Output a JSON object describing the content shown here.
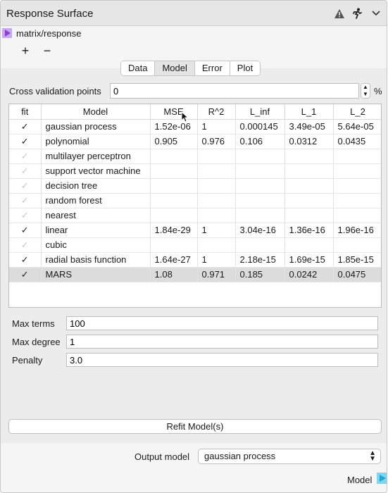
{
  "window": {
    "title": "Response Surface"
  },
  "titlebar_icons": [
    "warning-icon",
    "running-person-icon",
    "chevron-down-icon"
  ],
  "input_port": {
    "label": "matrix/response"
  },
  "buttons": {
    "add": "+",
    "remove": "−"
  },
  "tabs": [
    {
      "label": "Data",
      "active": false
    },
    {
      "label": "Model",
      "active": true
    },
    {
      "label": "Error",
      "active": false
    },
    {
      "label": "Plot",
      "active": false
    }
  ],
  "cross_validation": {
    "label": "Cross validation points",
    "value": "0",
    "unit": "%"
  },
  "table": {
    "headers": [
      "fit",
      "Model",
      "MSE",
      "R^2",
      "L_inf",
      "L_1",
      "L_2"
    ],
    "rows": [
      {
        "fit": true,
        "model": "gaussian process",
        "mse": "1.52e-06",
        "r2": "1",
        "linf": "0.000145",
        "l1": "3.49e-05",
        "l2": "5.64e-05"
      },
      {
        "fit": true,
        "model": "polynomial",
        "mse": "0.905",
        "r2": "0.976",
        "linf": "0.106",
        "l1": "0.0312",
        "l2": "0.0435"
      },
      {
        "fit": false,
        "model": "multilayer perceptron",
        "mse": "",
        "r2": "",
        "linf": "",
        "l1": "",
        "l2": ""
      },
      {
        "fit": false,
        "model": "support vector machine",
        "mse": "",
        "r2": "",
        "linf": "",
        "l1": "",
        "l2": ""
      },
      {
        "fit": false,
        "model": "decision tree",
        "mse": "",
        "r2": "",
        "linf": "",
        "l1": "",
        "l2": ""
      },
      {
        "fit": false,
        "model": "random forest",
        "mse": "",
        "r2": "",
        "linf": "",
        "l1": "",
        "l2": ""
      },
      {
        "fit": false,
        "model": "nearest",
        "mse": "",
        "r2": "",
        "linf": "",
        "l1": "",
        "l2": ""
      },
      {
        "fit": true,
        "model": "linear",
        "mse": "1.84e-29",
        "r2": "1",
        "linf": "3.04e-16",
        "l1": "1.36e-16",
        "l2": "1.96e-16"
      },
      {
        "fit": false,
        "model": "cubic",
        "mse": "",
        "r2": "",
        "linf": "",
        "l1": "",
        "l2": ""
      },
      {
        "fit": true,
        "model": "radial basis function",
        "mse": "1.64e-27",
        "r2": "1",
        "linf": "2.18e-15",
        "l1": "1.69e-15",
        "l2": "1.85e-15"
      },
      {
        "fit": true,
        "model": "MARS",
        "mse": "1.08",
        "r2": "0.971",
        "linf": "0.185",
        "l1": "0.0242",
        "l2": "0.0475"
      }
    ],
    "selected_row": 10,
    "check_glyph": "✓"
  },
  "params": {
    "max_terms": {
      "label": "Max terms",
      "value": "100"
    },
    "max_degree": {
      "label": "Max degree",
      "value": "1"
    },
    "penalty": {
      "label": "Penalty",
      "value": "3.0"
    }
  },
  "refit_button": "Refit Model(s)",
  "output_model": {
    "label": "Output model",
    "value": "gaussian process"
  },
  "output_port": {
    "label": "Model"
  }
}
